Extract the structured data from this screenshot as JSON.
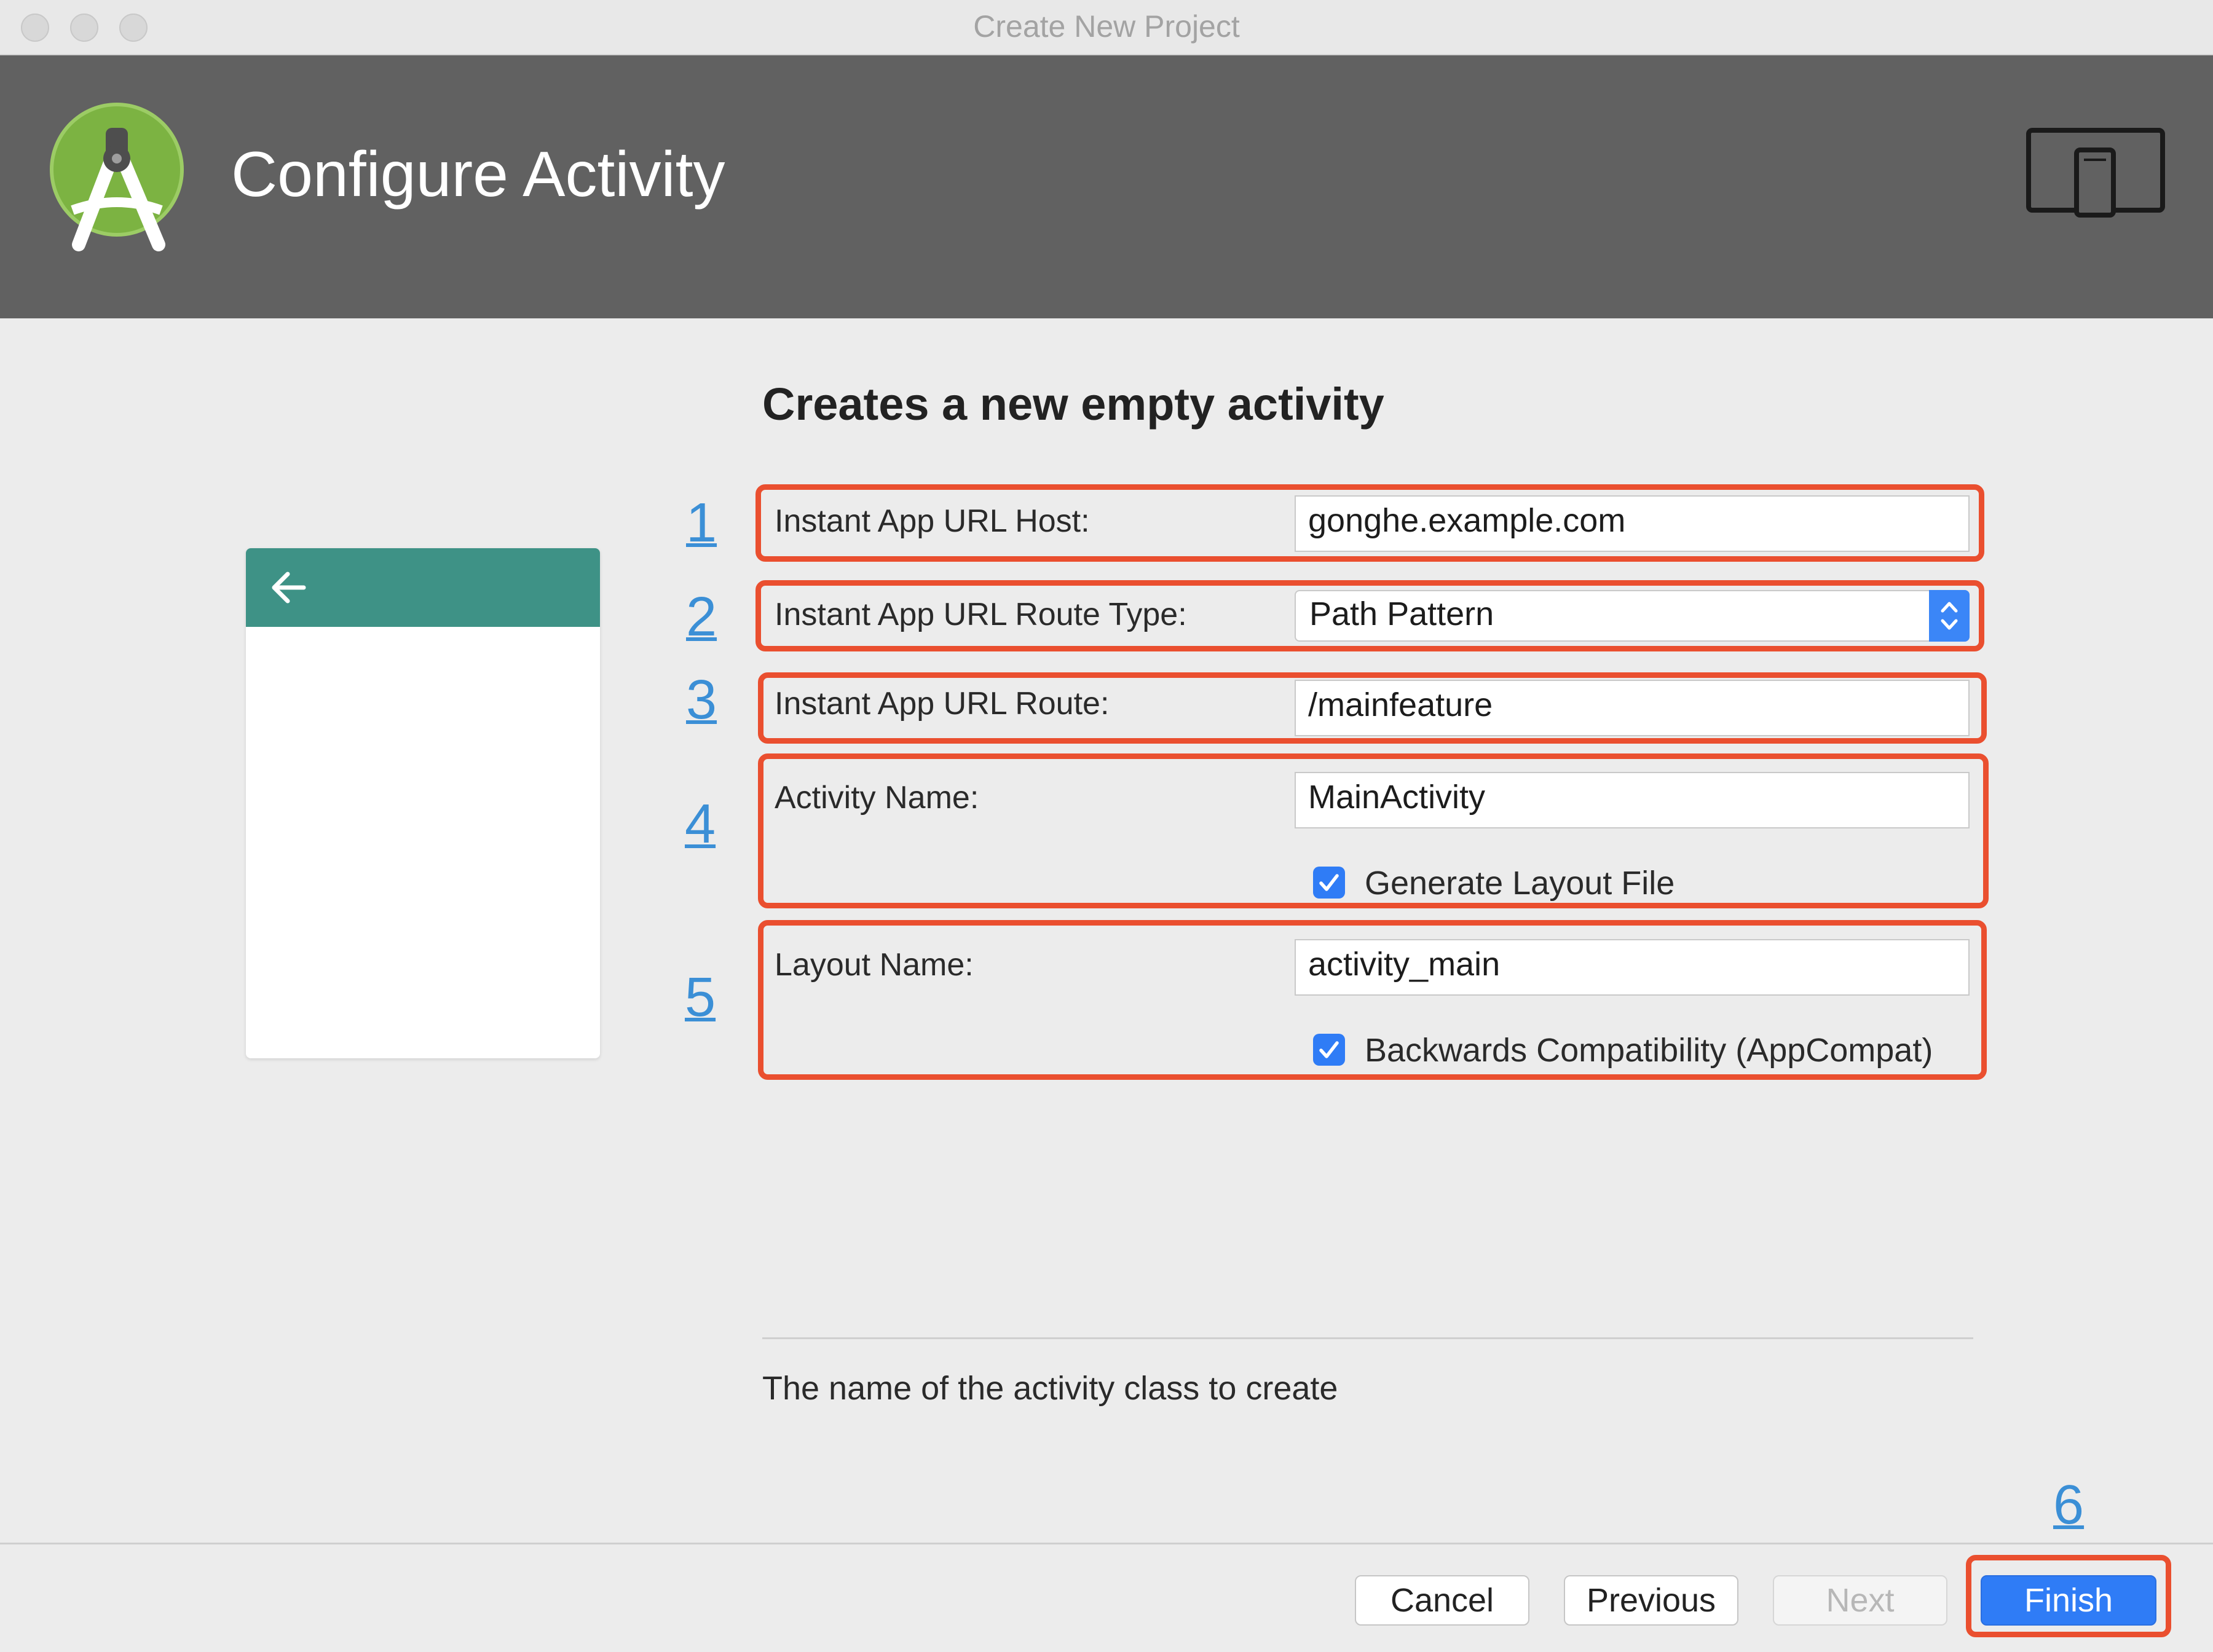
{
  "window": {
    "title": "Create New Project"
  },
  "header": {
    "title": "Configure Activity",
    "logo_icon": "android-studio-logo-icon",
    "device_icon": "device-preview-icon"
  },
  "section_title": "Creates a new empty activity",
  "steps": [
    "1",
    "2",
    "3",
    "4",
    "5",
    "6"
  ],
  "form": {
    "url_host": {
      "label": "Instant App URL Host:",
      "value": "gonghe.example.com"
    },
    "route_type": {
      "label": "Instant App URL Route Type:",
      "value": "Path Pattern"
    },
    "route": {
      "label": "Instant App URL Route:",
      "value": "/mainfeature"
    },
    "activity_name": {
      "label": "Activity Name:",
      "value": "MainActivity"
    },
    "generate_layout": {
      "label": "Generate Layout File",
      "checked": true
    },
    "layout_name": {
      "label": "Layout Name:",
      "value": "activity_main"
    },
    "backwards_compat": {
      "label": "Backwards Compatibility (AppCompat)",
      "checked": true
    }
  },
  "description": "The name of the activity class to create",
  "buttons": {
    "cancel": "Cancel",
    "previous": "Previous",
    "next": "Next",
    "finish": "Finish"
  },
  "colors": {
    "header_bg": "#616161",
    "highlight": "#ea4f2f",
    "step_number": "#3b8fd6",
    "accent": "#2f7cf6",
    "preview_toolbar": "#3e9286"
  }
}
